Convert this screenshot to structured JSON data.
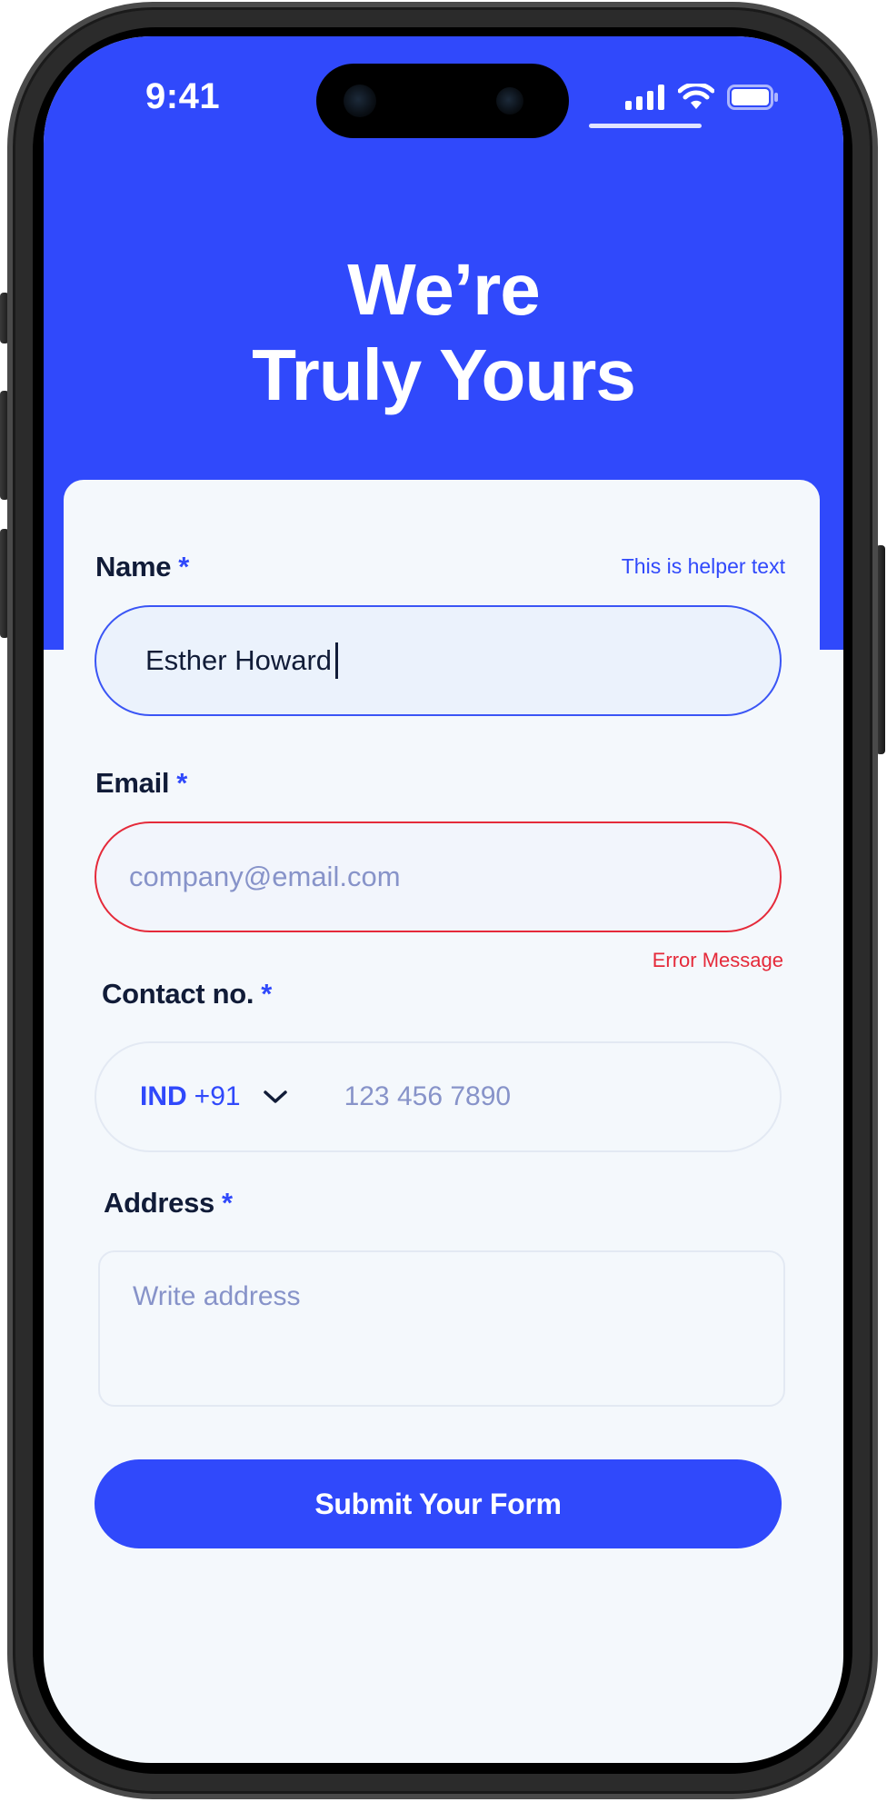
{
  "status_bar": {
    "time": "9:41",
    "icons": [
      "cellular-signal-icon",
      "wifi-icon",
      "battery-icon"
    ]
  },
  "hero": {
    "line1": "We’re",
    "line2": "Truly Yours"
  },
  "form": {
    "name": {
      "label": "Name",
      "required_mark": "*",
      "helper_text": "This is helper text",
      "value": "Esther Howard"
    },
    "email": {
      "label": "Email",
      "required_mark": "*",
      "placeholder": "company@email.com",
      "error_message": "Error Message"
    },
    "contact": {
      "label": "Contact no.",
      "required_mark": "*",
      "country_code": "IND",
      "dial_code": "+91",
      "placeholder": "123 456 7890"
    },
    "address": {
      "label": "Address",
      "required_mark": "*",
      "placeholder": "Write address"
    },
    "submit_label": "Submit Your Form"
  },
  "colors": {
    "primary": "#3049FB",
    "error": "#E52A3A",
    "text_dark": "#111C38",
    "placeholder": "#8793C9",
    "background": "#F4F8FC"
  }
}
